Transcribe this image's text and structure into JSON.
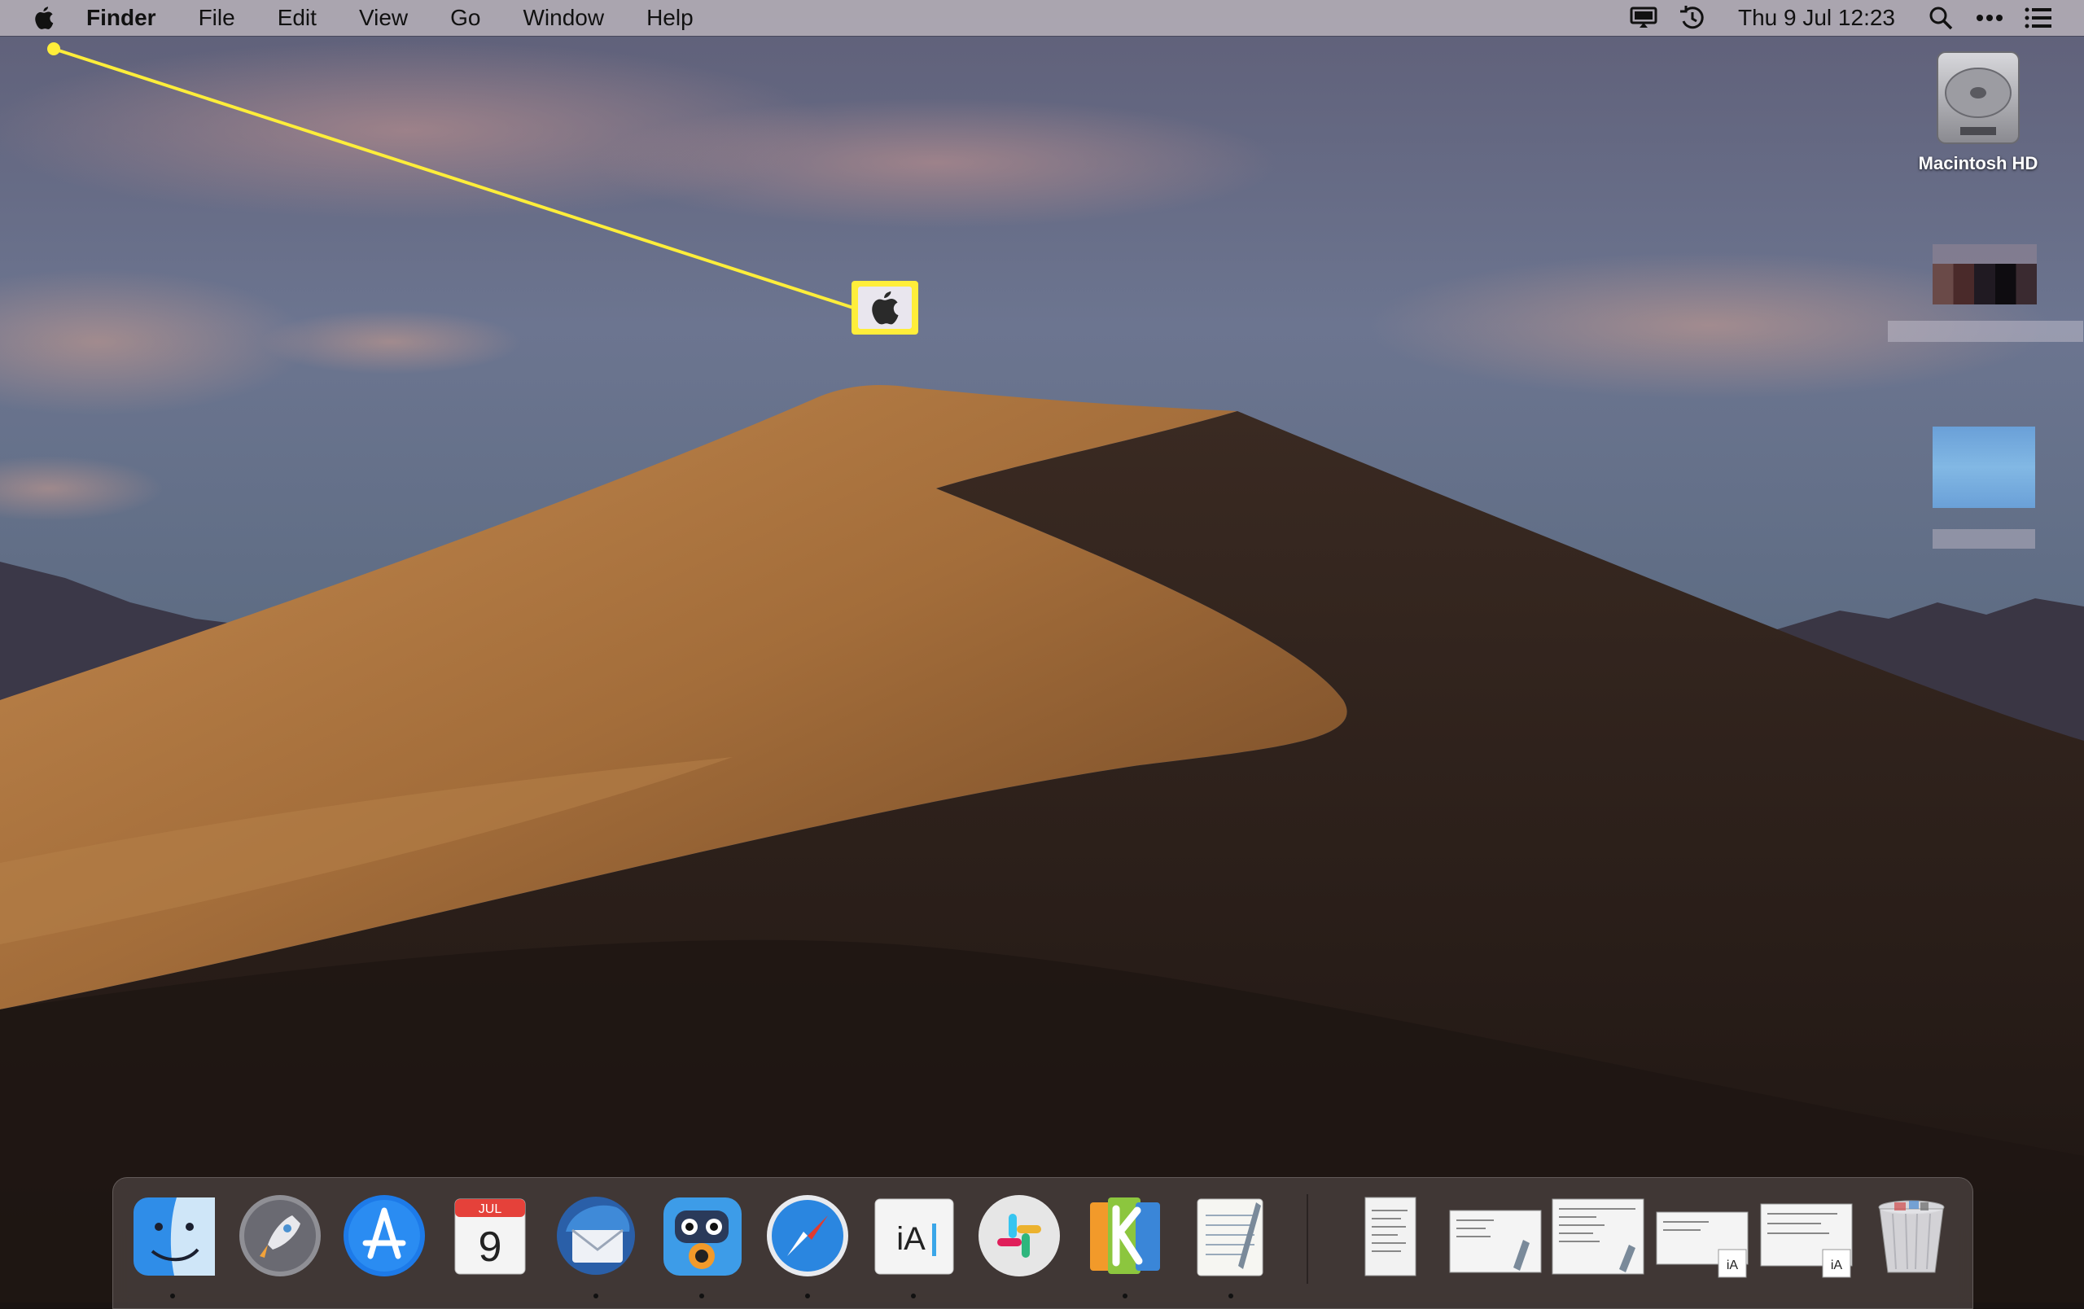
{
  "menubar": {
    "app_name": "Finder",
    "items": [
      "File",
      "Edit",
      "View",
      "Go",
      "Window",
      "Help"
    ],
    "clock": "Thu 9 Jul  12:23",
    "status_icons": [
      "display-icon",
      "time-machine-icon",
      "spotlight-icon",
      "more-icon",
      "control-center-icon"
    ]
  },
  "desktop": {
    "drive_label": "Macintosh HD"
  },
  "dock": {
    "calendar_month": "JUL",
    "calendar_day": "9",
    "apps": [
      "finder",
      "launchpad",
      "app-store",
      "calendar",
      "thunderbird",
      "tweetbot",
      "safari",
      "ia-writer",
      "slack",
      "kanbanier",
      "textedit"
    ],
    "docs": [
      "document-1",
      "document-2",
      "document-3",
      "document-4",
      "document-5"
    ],
    "trash": "trash"
  },
  "colors": {
    "menubar_bg": "#afaab4",
    "highlight": "#ffee3a"
  }
}
